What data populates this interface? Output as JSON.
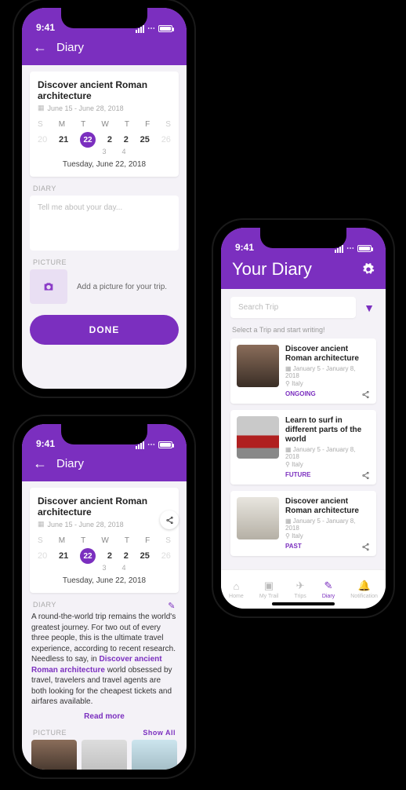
{
  "status": {
    "time": "9:41"
  },
  "phone1": {
    "header_title": "Diary",
    "trip_title": "Discover ancient Roman architecture",
    "trip_dates": "June 15 - June 28, 2018",
    "weekdays": [
      "S",
      "M",
      "T",
      "W",
      "T",
      "F",
      "S"
    ],
    "dates_top": [
      "20",
      "21",
      "22",
      "2",
      "2",
      "25",
      "26"
    ],
    "dates_bottom": [
      "",
      "",
      "",
      "3",
      "4",
      "",
      ""
    ],
    "selected_index": 2,
    "date_label": "Tuesday, June 22, 2018",
    "diary_label": "DIARY",
    "placeholder": "Tell me about your day...",
    "picture_label": "PICTURE",
    "picture_hint": "Add a picture for your trip.",
    "done": "DONE"
  },
  "phone2": {
    "header_title": "Your Diary",
    "search_placeholder": "Search Trip",
    "hint": "Select a Trip and start writing!",
    "cards": [
      {
        "title": "Discover ancient Roman architecture",
        "dates": "January 5 - January 8, 2018",
        "location": "Italy",
        "status": "ONGOING",
        "img": "img-forest"
      },
      {
        "title": "Learn to surf in different parts of the world",
        "dates": "January 5 - January 8, 2018",
        "location": "Italy",
        "status": "FUTURE",
        "img": "img-bus"
      },
      {
        "title": "Discover ancient Roman architecture",
        "dates": "January 5 - January 8, 2018",
        "location": "Italy",
        "status": "PAST",
        "img": "img-city"
      }
    ],
    "nav": [
      {
        "label": "Home",
        "icon": "⌂"
      },
      {
        "label": "My Trail",
        "icon": "▣"
      },
      {
        "label": "Trips",
        "icon": "✈"
      },
      {
        "label": "Diary",
        "icon": "✎"
      },
      {
        "label": "Notification",
        "icon": "🔔"
      }
    ],
    "nav_active": 3
  },
  "phone3": {
    "header_title": "Diary",
    "trip_title": "Discover ancient Roman architecture",
    "trip_dates": "June 15 - June 28, 2018",
    "weekdays": [
      "S",
      "M",
      "T",
      "W",
      "T",
      "F",
      "S"
    ],
    "dates_top": [
      "20",
      "21",
      "22",
      "2",
      "2",
      "25",
      "26"
    ],
    "dates_bottom": [
      "",
      "",
      "",
      "3",
      "4",
      "",
      ""
    ],
    "selected_index": 2,
    "date_label": "Tuesday, June 22, 2018",
    "diary_label": "DIARY",
    "body_pre": "A round-the-world trip remains the world's greatest journey. For two out of every three people, this is the ultimate travel experience, according to recent research. Needless to say, in ",
    "body_link": "Discover ancient Roman architecture",
    "body_post": " world obsessed by travel, travelers and travel agents are both looking for the cheapest tickets and airfares available.",
    "read_more": "Read more",
    "picture_label": "PICTURE",
    "show_all": "Show All"
  }
}
